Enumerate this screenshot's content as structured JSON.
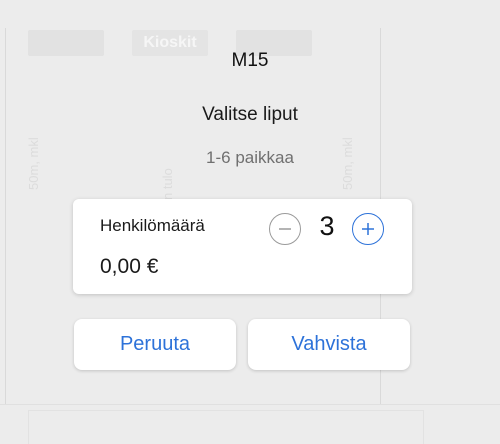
{
  "background": {
    "kioski_label": "Kioskit",
    "left_vertical_label": "50m, mkl",
    "center_vertical_label": "n tulo",
    "right_vertical_label": "50m, mkl"
  },
  "dialog": {
    "title": "M15",
    "subtitle": "Valitse liput",
    "seat_range": "1-6 paikkaa",
    "quantity": {
      "label": "Henkilömäärä",
      "count": "3",
      "price": "0,00 €"
    },
    "cancel_label": "Peruuta",
    "confirm_label": "Vahvista"
  },
  "colors": {
    "accent": "#2d72d9",
    "background": "#ececec"
  }
}
